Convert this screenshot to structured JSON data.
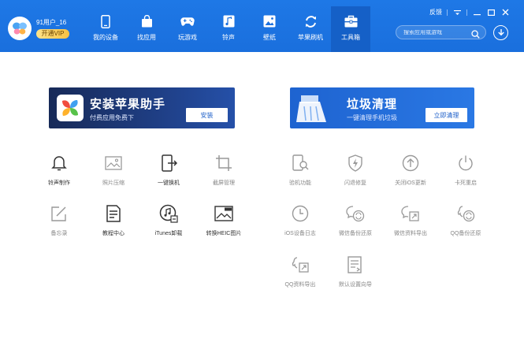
{
  "user": {
    "name": "91用户_16",
    "vip": "开通VIP"
  },
  "nav": [
    {
      "label": "我的设备",
      "icon": "phone-icon"
    },
    {
      "label": "找应用",
      "icon": "bag-icon"
    },
    {
      "label": "玩游戏",
      "icon": "gamepad-icon"
    },
    {
      "label": "铃声",
      "icon": "music-icon"
    },
    {
      "label": "壁纸",
      "icon": "image-icon"
    },
    {
      "label": "苹果刷机",
      "icon": "refresh-icon"
    },
    {
      "label": "工具箱",
      "icon": "toolbox-icon"
    }
  ],
  "active_nav": "工具箱",
  "window": {
    "feedback": "反馈"
  },
  "search": {
    "placeholder": "搜索应用或游戏"
  },
  "banners": {
    "install": {
      "title": "安装苹果助手",
      "subtitle": "付费应用免费下",
      "button": "安装"
    },
    "clean": {
      "title": "垃圾清理",
      "subtitle": "一键清理手机垃圾",
      "button": "立即清理"
    }
  },
  "tools_left": [
    {
      "label": "铃声制作",
      "icon": "bell-icon"
    },
    {
      "label": "照片压缩",
      "icon": "photo-icon"
    },
    {
      "label": "一键换机",
      "icon": "transfer-icon"
    },
    {
      "label": "截屏管理",
      "icon": "crop-icon"
    },
    {
      "label": "备忘录",
      "icon": "memo-icon"
    },
    {
      "label": "教程中心",
      "icon": "document-icon"
    },
    {
      "label": "iTunes卸载",
      "icon": "itunes-icon"
    },
    {
      "label": "转换HEIC图片",
      "icon": "heic-icon"
    }
  ],
  "tools_right": [
    {
      "label": "验机功能",
      "icon": "inspect-icon"
    },
    {
      "label": "闪退修复",
      "icon": "shield-icon"
    },
    {
      "label": "关闭iOS更新",
      "icon": "upload-icon"
    },
    {
      "label": "卡死重启",
      "icon": "power-icon"
    },
    {
      "label": "iOS设备日志",
      "icon": "clock-icon"
    },
    {
      "label": "微信备份还原",
      "icon": "wechat-backup-icon"
    },
    {
      "label": "微信资料导出",
      "icon": "wechat-export-icon"
    },
    {
      "label": "QQ备份还原",
      "icon": "qq-backup-icon"
    },
    {
      "label": "QQ资料导出",
      "icon": "qq-export-icon"
    },
    {
      "label": "默认设置向导",
      "icon": "settings-guide-icon"
    }
  ],
  "colors": {
    "topbar": "#1a6fdd",
    "accent": "#1c5fc9",
    "banner_a": "#1f3f86",
    "banner_b": "#2a78e4"
  }
}
